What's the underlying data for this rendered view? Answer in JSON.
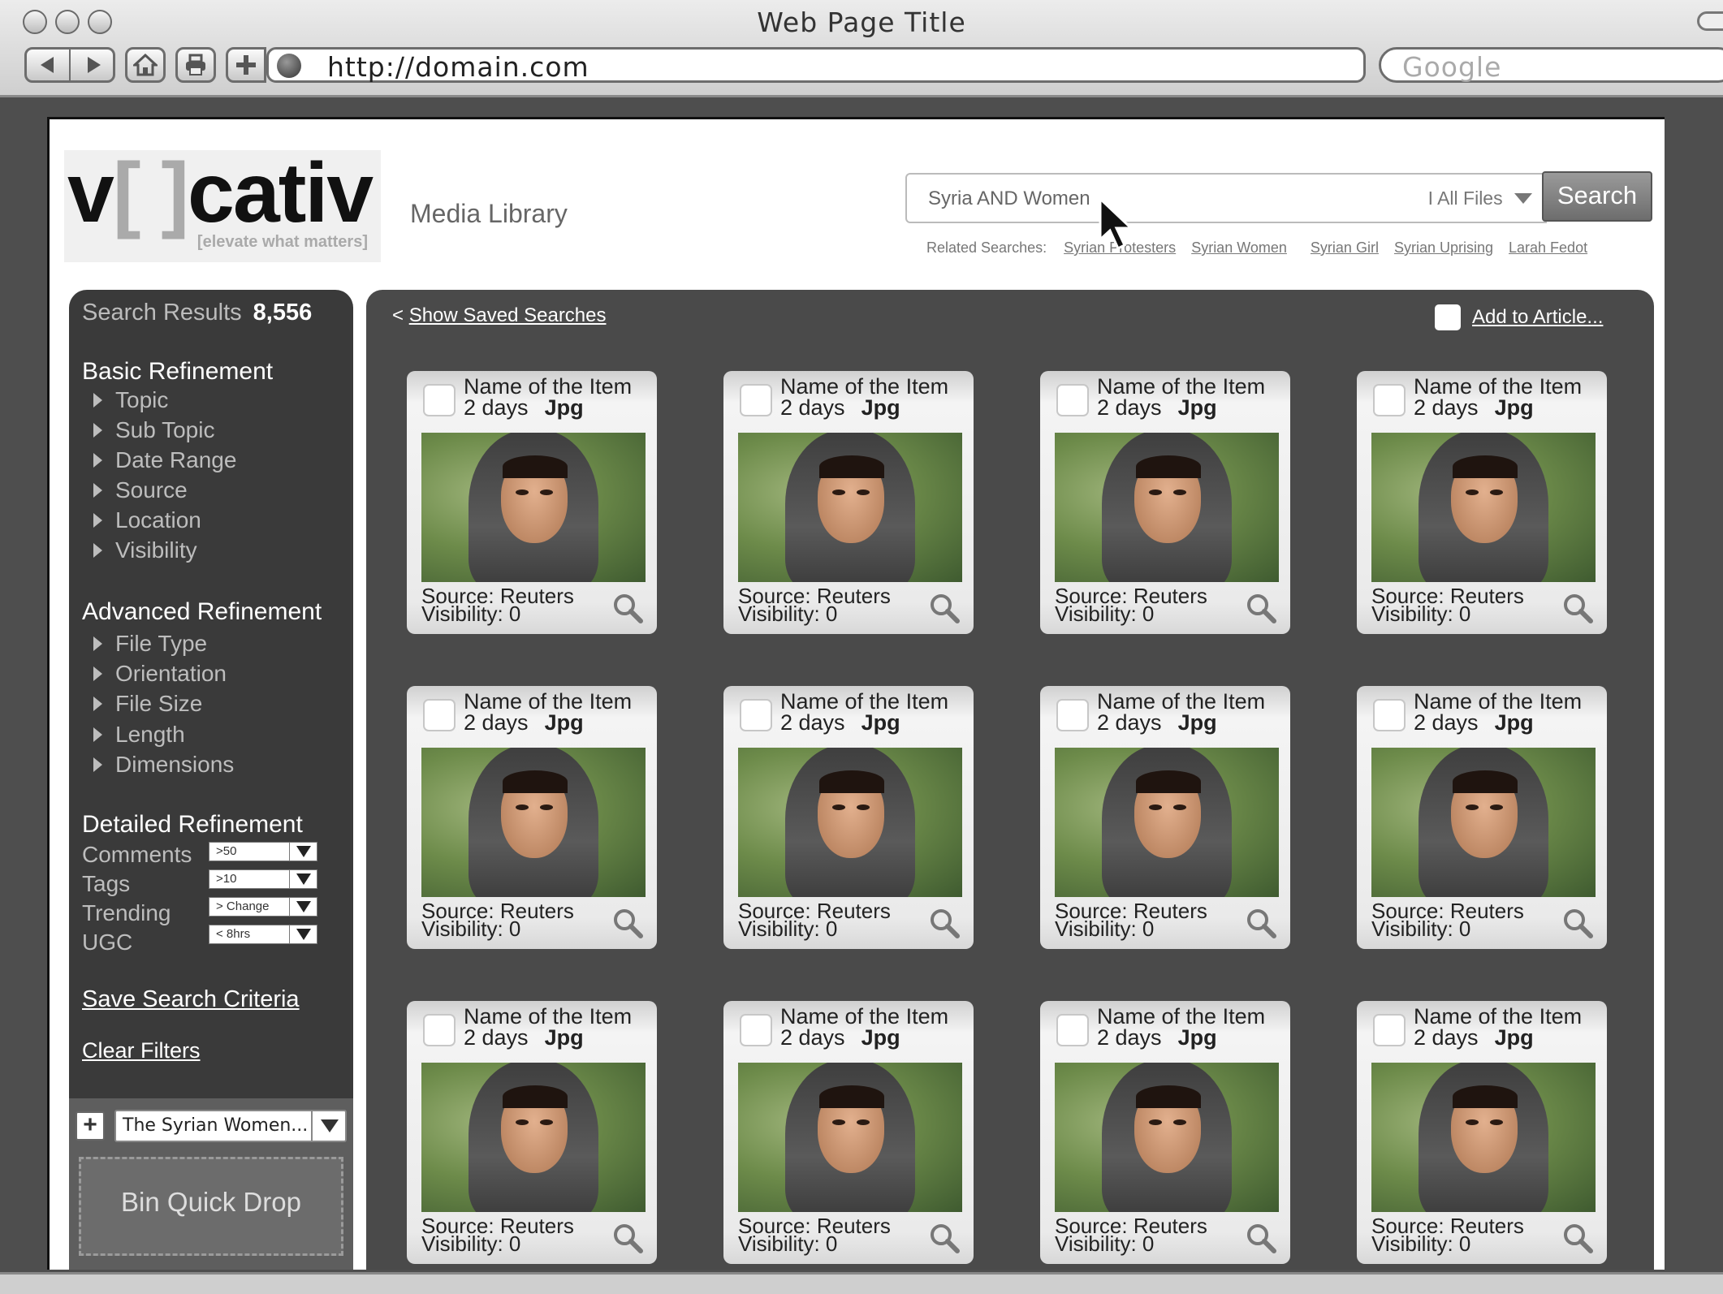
{
  "browser": {
    "window_title": "Web Page Title",
    "url": "http://domain.com",
    "search_placeholder": "Google"
  },
  "header": {
    "logo_text_a": "v",
    "logo_text_bracket": "[ ]",
    "logo_text_b": "cativ",
    "logo_tagline": "[elevate what matters]",
    "section_title": "Media Library",
    "search": {
      "query": "Syria AND Women",
      "scope": "I  All Files",
      "button_label": "Search"
    },
    "related": {
      "label": "Related Searches:",
      "items": [
        "Syrian Protesters",
        "Syrian Women",
        "Syrian Girl",
        "Syrian Uprising",
        "Larah Fedot"
      ]
    }
  },
  "sidebar": {
    "results_label": "Search Results",
    "results_count": "8,556",
    "basic": {
      "title": "Basic Refinement",
      "items": [
        "Topic",
        "Sub Topic",
        "Date Range",
        "Source",
        "Location",
        "Visibility"
      ]
    },
    "advanced": {
      "title": "Advanced Refinement",
      "items": [
        "File Type",
        "Orientation",
        "File Size",
        "Length",
        "Dimensions"
      ]
    },
    "detailed": {
      "title": "Detailed Refinement",
      "rows": [
        {
          "label": "Comments",
          "value": ">50"
        },
        {
          "label": "Tags",
          "value": ">10"
        },
        {
          "label": "Trending",
          "value": "> Change"
        },
        {
          "label": "UGC",
          "value": "< 8hrs"
        }
      ]
    },
    "save_label": "Save Search Criteria",
    "clear_label": "Clear Filters",
    "bin": {
      "plus": "+",
      "selected": "The Syrian Women...",
      "drop_label": "Bin Quick Drop"
    }
  },
  "results": {
    "show_saved": "Show Saved Searches",
    "show_saved_prefix": "< ",
    "add_to_article": "Add to Article...",
    "items": [
      {
        "name": "Name of the Item",
        "age": "2 days",
        "type": "Jpg",
        "source": "Source: Reuters",
        "visibility": "Visibility: 0"
      },
      {
        "name": "Name of the Item",
        "age": "2 days",
        "type": "Jpg",
        "source": "Source: Reuters",
        "visibility": "Visibility: 0"
      },
      {
        "name": "Name of the Item",
        "age": "2 days",
        "type": "Jpg",
        "source": "Source: Reuters",
        "visibility": "Visibility: 0"
      },
      {
        "name": "Name of the Item",
        "age": "2 days",
        "type": "Jpg",
        "source": "Source: Reuters",
        "visibility": "Visibility: 0"
      },
      {
        "name": "Name of the Item",
        "age": "2 days",
        "type": "Jpg",
        "source": "Source: Reuters",
        "visibility": "Visibility: 0"
      },
      {
        "name": "Name of the Item",
        "age": "2 days",
        "type": "Jpg",
        "source": "Source: Reuters",
        "visibility": "Visibility: 0"
      },
      {
        "name": "Name of the Item",
        "age": "2 days",
        "type": "Jpg",
        "source": "Source: Reuters",
        "visibility": "Visibility: 0"
      },
      {
        "name": "Name of the Item",
        "age": "2 days",
        "type": "Jpg",
        "source": "Source: Reuters",
        "visibility": "Visibility: 0"
      },
      {
        "name": "Name of the Item",
        "age": "2 days",
        "type": "Jpg",
        "source": "Source: Reuters",
        "visibility": "Visibility: 0"
      },
      {
        "name": "Name of the Item",
        "age": "2 days",
        "type": "Jpg",
        "source": "Source: Reuters",
        "visibility": "Visibility: 0"
      },
      {
        "name": "Name of the Item",
        "age": "2 days",
        "type": "Jpg",
        "source": "Source: Reuters",
        "visibility": "Visibility: 0"
      },
      {
        "name": "Name of the Item",
        "age": "2 days",
        "type": "Jpg",
        "source": "Source: Reuters",
        "visibility": "Visibility: 0"
      }
    ]
  },
  "icons": {
    "back": "back-arrow-icon",
    "forward": "forward-arrow-icon",
    "home": "home-icon",
    "print": "printer-icon",
    "add": "plus-icon",
    "globe": "globe-icon",
    "zoom": "magnifier-icon",
    "cursor": "mouse-cursor-icon"
  }
}
